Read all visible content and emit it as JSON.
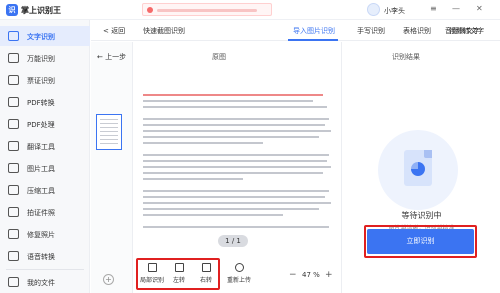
{
  "app": {
    "title": "掌上识别王",
    "logo_char": "识"
  },
  "user": {
    "name": "小李头"
  },
  "window": {
    "menu": "≡",
    "minimize": "—",
    "close": "✕"
  },
  "sidebar": {
    "items": [
      {
        "label": "文字识别"
      },
      {
        "label": "万能识别"
      },
      {
        "label": "票证识别"
      },
      {
        "label": "PDF转换"
      },
      {
        "label": "PDF处理"
      },
      {
        "label": "翻译工具"
      },
      {
        "label": "图片工具"
      },
      {
        "label": "压缩工具"
      },
      {
        "label": "拍证件照"
      },
      {
        "label": "修复照片"
      },
      {
        "label": "语音转换"
      }
    ],
    "files_label": "我的文件"
  },
  "tabs": {
    "back": "< 返回",
    "items": [
      "快速截图识别",
      "导入图片识别",
      "手写识别",
      "表格识别",
      "音频转文字",
      "视频转文字"
    ]
  },
  "thumbs": {
    "prev_label": "← 上一步",
    "add": "+"
  },
  "original": {
    "title": "原图",
    "pager": "1 / 1"
  },
  "toolbar": {
    "crop": "局部识别",
    "rotate_left": "左转",
    "rotate_right": "右转",
    "reupload": "重新上传",
    "zoom_minus": "−",
    "zoom_value": "47 %",
    "zoom_plus": "+"
  },
  "result": {
    "title": "识别结果",
    "waiting": "等待识别中",
    "tip": "图片越清晰，识别越精准",
    "start_button": "立即识别"
  }
}
